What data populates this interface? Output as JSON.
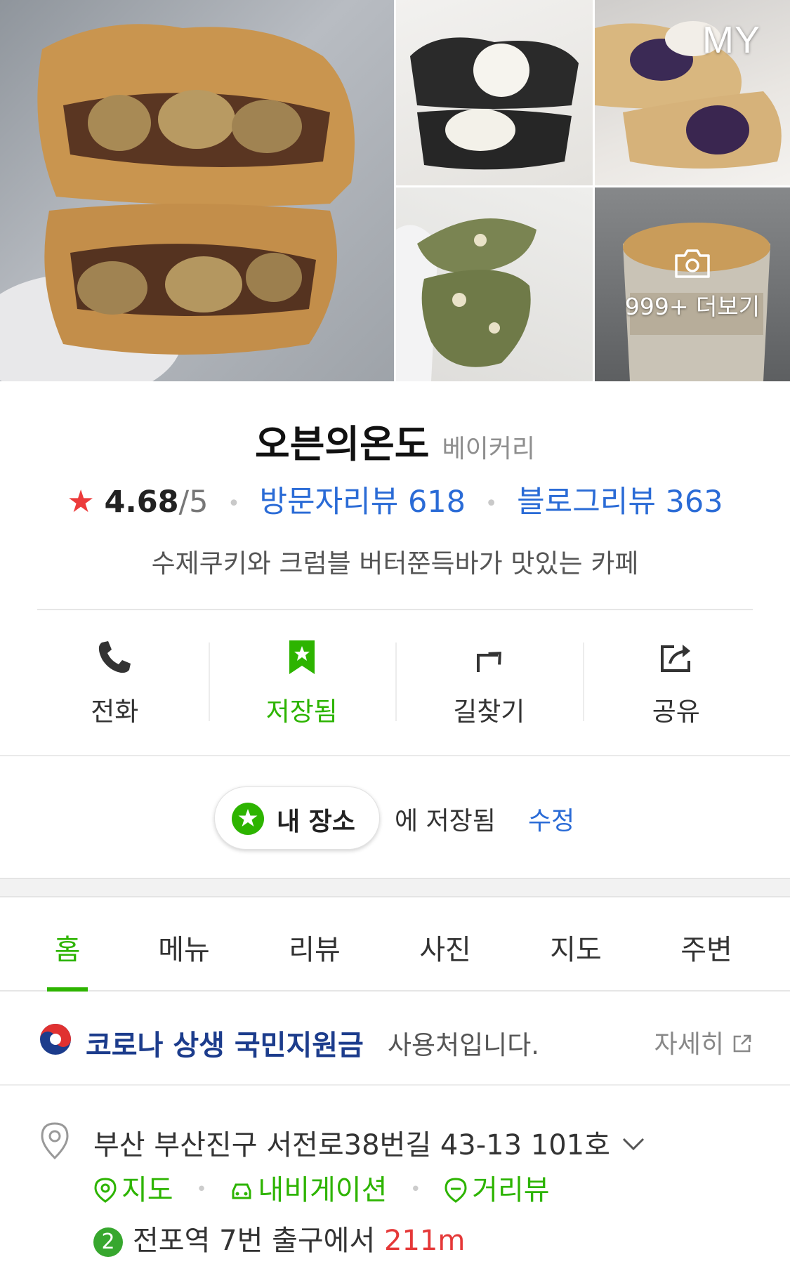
{
  "photos": {
    "my_label": "MY",
    "more_label": "999+ 더보기"
  },
  "place": {
    "name": "오븐의온도",
    "category": "베이커리",
    "rating": "4.68",
    "rating_max": "/5",
    "visitor_review": "방문자리뷰 618",
    "blog_review": "블로그리뷰 363",
    "description": "수제쿠키와 크럼블 버터쭌득바가 맛있는 카페"
  },
  "actions": [
    {
      "label": "전화",
      "icon": "phone-icon"
    },
    {
      "label": "저장됨",
      "icon": "bookmark-star-icon"
    },
    {
      "label": "길찾기",
      "icon": "directions-icon"
    },
    {
      "label": "공유",
      "icon": "share-icon"
    }
  ],
  "saved": {
    "folder": "내 장소",
    "text": "에 저장됨",
    "edit": "수정"
  },
  "tabs": [
    "홈",
    "메뉴",
    "리뷰",
    "사진",
    "지도",
    "주변"
  ],
  "active_tab": "홈",
  "corona": {
    "title": "코로나 상생 국민지원금",
    "subtitle": "사용처입니다.",
    "more": "자세히"
  },
  "address": {
    "text": "부산 부산진구 서전로38번길 43-13 101호",
    "links": [
      "지도",
      "내비게이션",
      "거리뷰"
    ],
    "line_number": "2",
    "station": "전포역 7번 출구에서",
    "distance": "211m"
  },
  "colors": {
    "accent_green": "#2db400",
    "link_blue": "#2a6bd6",
    "star_red": "#ec3b3b",
    "distance_red": "#e53838"
  }
}
